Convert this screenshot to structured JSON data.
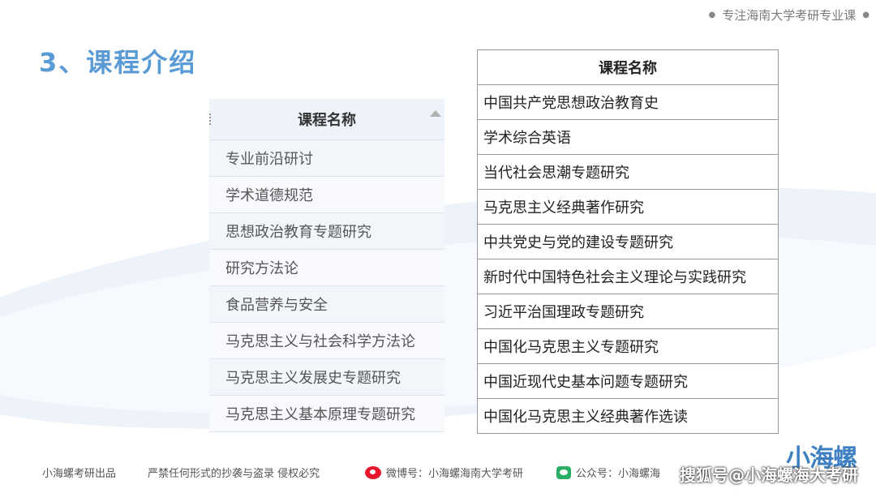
{
  "header": {
    "tag_text": "专注海南大学考研专业课"
  },
  "title": "3、课程介绍",
  "left_table": {
    "header": "课程名称",
    "rows": [
      "专业前沿研讨",
      "学术道德规范",
      "思想政治教育专题研究",
      "研究方法论",
      "食品营养与安全",
      "马克思主义与社会科学方法论",
      "马克思主义发展史专题研究",
      "马克思主义基本原理专题研究"
    ]
  },
  "right_table": {
    "header": "课程名称",
    "rows": [
      "中国共产党思想政治教育史",
      "学术综合英语",
      "当代社会思潮专题研究",
      "马克思主义经典著作研究",
      "中共党史与党的建设专题研究",
      "新时代中国特色社会主义理论与实践研究",
      "习近平治国理政专题研究",
      "中国化马克思主义专题研究",
      "中国近现代史基本问题专题研究",
      "中国化马克思主义经典著作选读"
    ]
  },
  "footer": {
    "producer": "小海螺考研出品",
    "copyright": "严禁任何形式的抄袭与盗录  侵权必究",
    "weibo": "微博号：小海螺海南大学考研",
    "wechat": "公众号：小海螺海"
  },
  "logo_text": "小海螺",
  "watermark": "搜狐号@小海螺海大考研",
  "icons": {
    "weibo": "weibo-icon",
    "wechat": "wechat-icon",
    "sort": "sort-up-icon"
  },
  "colors": {
    "title": "#5b9bd5",
    "logo": "#3d7fc1"
  }
}
